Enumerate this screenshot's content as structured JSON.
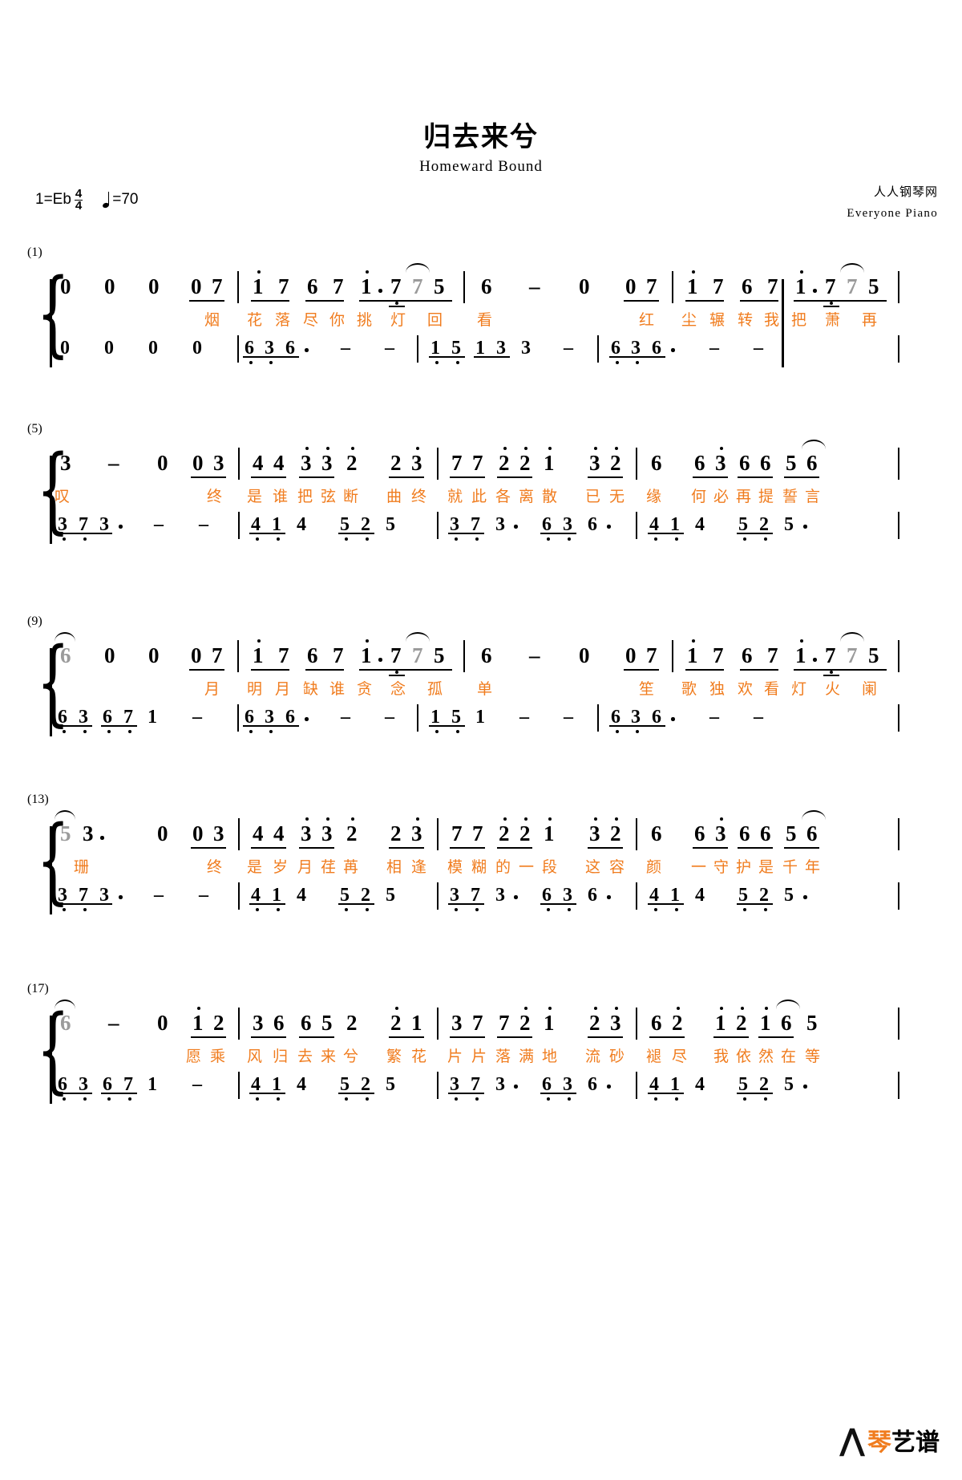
{
  "header": {
    "title": "归去来兮",
    "subtitle": "Homeward Bound",
    "key_label": "1=Eb",
    "meter_num": "4",
    "meter_den": "4",
    "tempo_value": "=70",
    "publisher_cn": "人人钢琴网",
    "publisher_en": "Everyone Piano"
  },
  "watermark": {
    "brand_mark": "⋀",
    "brand_text_1": "琴",
    "brand_text_2": "艺谱"
  },
  "systems": [
    {
      "number": "(1)",
      "melody": [
        "0",
        "0",
        "0",
        "0",
        "7",
        "1",
        "7",
        "6",
        "7",
        "1·",
        "7",
        "7",
        "5",
        "6",
        "–",
        "0",
        "0",
        "7",
        "1",
        "7",
        "6",
        "7",
        "1·",
        "7",
        "7",
        "5"
      ],
      "lyrics": [
        "烟",
        "花",
        "落",
        "尽",
        "你",
        "挑",
        "灯",
        "回",
        "看",
        "红",
        "尘",
        "辗",
        "转",
        "我",
        "把",
        "萧",
        "再"
      ],
      "bass": [
        "6",
        "3",
        "6",
        "·",
        "–",
        "–",
        "1",
        "5",
        "1",
        "3",
        "3",
        "–",
        "6",
        "3",
        "6",
        "·",
        "–",
        "–"
      ]
    },
    {
      "number": "(5)",
      "melody": [
        "3",
        "–",
        "0",
        "0",
        "3",
        "4",
        "4",
        "3",
        "3",
        "2",
        "2",
        "3",
        "7",
        "7",
        "2",
        "2",
        "1",
        "3",
        "2",
        "6",
        "6",
        "3",
        "6",
        "6",
        "5",
        "6"
      ],
      "lyrics": [
        "叹",
        "终",
        "是",
        "谁",
        "把",
        "弦",
        "断",
        "曲",
        "终",
        "就",
        "此",
        "各",
        "离",
        "散",
        "已",
        "无",
        "缘",
        "何",
        "必",
        "再",
        "提",
        "誓",
        "言"
      ],
      "bass": [
        "3",
        "7",
        "3",
        "–",
        "–",
        "4",
        "1",
        "4",
        "5",
        "2",
        "5",
        "3",
        "7",
        "3",
        "6",
        "3",
        "6",
        "4",
        "1",
        "4",
        "5",
        "2",
        "5"
      ]
    },
    {
      "number": "(9)",
      "melody": [
        "6",
        "0",
        "0",
        "0",
        "7",
        "1",
        "7",
        "6",
        "7",
        "1·",
        "7",
        "7",
        "5",
        "6",
        "–",
        "0",
        "0",
        "7",
        "1",
        "7",
        "6",
        "7",
        "1·",
        "7",
        "7",
        "5"
      ],
      "lyrics": [
        "月",
        "明",
        "月",
        "缺",
        "谁",
        "贪",
        "念",
        "孤",
        "单",
        "笙",
        "歌",
        "独",
        "欢",
        "看",
        "灯",
        "火",
        "阑"
      ],
      "bass": [
        "6",
        "3",
        "6",
        "7",
        "1",
        "–",
        "6",
        "3",
        "6",
        "·",
        "–",
        "–",
        "1",
        "5",
        "1",
        "–",
        "–",
        "6",
        "3",
        "6",
        "·",
        "–",
        "–"
      ]
    },
    {
      "number": "(13)",
      "melody": [
        "5",
        "3·",
        "0",
        "0",
        "3",
        "4",
        "4",
        "3",
        "3",
        "2",
        "2",
        "3",
        "7",
        "7",
        "2",
        "2",
        "1",
        "3",
        "2",
        "6",
        "6",
        "3",
        "6",
        "6",
        "5",
        "6"
      ],
      "lyrics": [
        "珊",
        "终",
        "是",
        "岁",
        "月",
        "荏",
        "苒",
        "相",
        "逢",
        "模",
        "糊",
        "的",
        "一",
        "段",
        "这",
        "容",
        "颜",
        "一",
        "守",
        "护",
        "是",
        "千",
        "年"
      ],
      "bass": [
        "3",
        "7",
        "3",
        "–",
        "–",
        "4",
        "1",
        "4",
        "5",
        "2",
        "5",
        "3",
        "7",
        "3",
        "6",
        "3",
        "6",
        "4",
        "1",
        "4",
        "5",
        "2",
        "5"
      ]
    },
    {
      "number": "(17)",
      "melody": [
        "6",
        "–",
        "0",
        "1",
        "2",
        "3",
        "6",
        "6",
        "5",
        "2",
        "2",
        "1",
        "3",
        "7",
        "7",
        "2",
        "1",
        "2",
        "3",
        "6",
        "2",
        "1",
        "2",
        "1",
        "6",
        "5"
      ],
      "lyrics": [
        "愿",
        "乘",
        "风",
        "归",
        "去",
        "来",
        "兮",
        "繁",
        "花",
        "片",
        "片",
        "落",
        "满",
        "地",
        "流",
        "砂",
        "褪",
        "尽",
        "我",
        "依",
        "然",
        "在",
        "等"
      ],
      "bass": [
        "6",
        "3",
        "6",
        "7",
        "1",
        "–",
        "4",
        "1",
        "4",
        "5",
        "2",
        "5",
        "3",
        "7",
        "3",
        "6",
        "3",
        "6",
        "4",
        "1",
        "4",
        "5",
        "2",
        "5"
      ]
    }
  ]
}
